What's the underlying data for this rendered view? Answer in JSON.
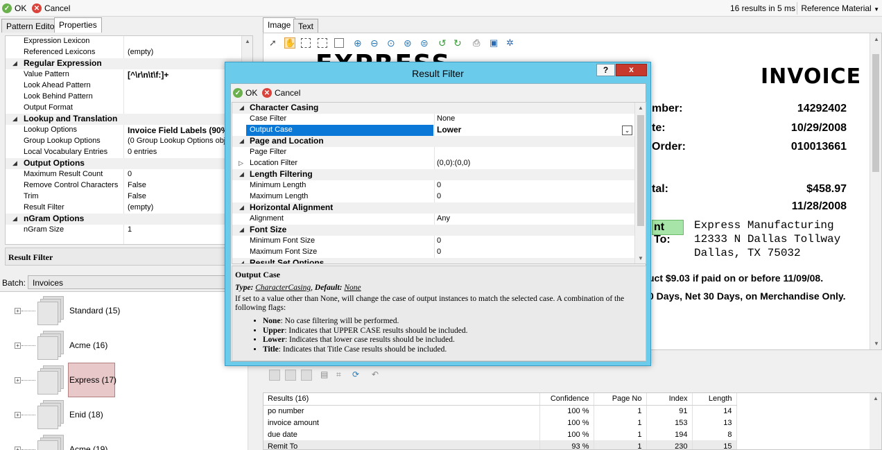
{
  "toolbar": {
    "ok_label": "OK",
    "cancel_label": "Cancel",
    "results_summary": "16 results in 5 ms",
    "reference_material": "Reference Material"
  },
  "left_tabs": [
    {
      "label": "Pattern Editor"
    },
    {
      "label": "Properties"
    }
  ],
  "properties": {
    "rows": [
      {
        "type": "prop",
        "name": "Expression Lexicon",
        "value": ""
      },
      {
        "type": "prop",
        "name": "Referenced Lexicons",
        "value": "(empty)"
      },
      {
        "type": "cat",
        "name": "Regular Expression"
      },
      {
        "type": "prop",
        "name": "Value Pattern",
        "value": "[^\\r\\n\\t\\f:]+",
        "bold": true
      },
      {
        "type": "prop",
        "name": "Look Ahead Pattern",
        "value": ""
      },
      {
        "type": "prop",
        "name": "Look Behind Pattern",
        "value": ""
      },
      {
        "type": "prop",
        "name": "Output Format",
        "value": ""
      },
      {
        "type": "cat",
        "name": "Lookup and Translation"
      },
      {
        "type": "prop",
        "name": "Lookup Options",
        "value": "Invoice Field Labels (90%",
        "bold": true
      },
      {
        "type": "prop",
        "name": "Group Lookup Options",
        "value": "(0 Group Lookup Options obje"
      },
      {
        "type": "prop",
        "name": "Local Vocabulary Entries",
        "value": "0 entries"
      },
      {
        "type": "cat",
        "name": "Output Options"
      },
      {
        "type": "prop",
        "name": "Maximum Result Count",
        "value": "0"
      },
      {
        "type": "prop",
        "name": "Remove Control Characters",
        "value": "False"
      },
      {
        "type": "prop",
        "name": "Trim",
        "value": "False"
      },
      {
        "type": "prop",
        "name": "Result Filter",
        "value": "(empty)"
      },
      {
        "type": "cat",
        "name": "nGram Options"
      },
      {
        "type": "prop",
        "name": "nGram Size",
        "value": "1"
      }
    ],
    "description_title": "Result Filter"
  },
  "batch": {
    "label": "Batch:",
    "value": "Invoices",
    "items": [
      {
        "label": "Standard (15)"
      },
      {
        "label": "Acme (16)"
      },
      {
        "label": "Express (17)"
      },
      {
        "label": "Enid (18)"
      },
      {
        "label": "Acme (19)"
      }
    ]
  },
  "right_tabs": [
    {
      "label": "Image"
    },
    {
      "label": "Text"
    }
  ],
  "invoice": {
    "brand": "EXPRESS",
    "title": "INVOICE",
    "lines": [
      {
        "label": "mber:",
        "value": "14292402"
      },
      {
        "label": "te:",
        "value": "10/29/2008"
      },
      {
        "label": "Order:",
        "value": "010013661"
      },
      {
        "label": "tal:",
        "value": "$458.97"
      },
      {
        "label": "",
        "value": "11/28/2008"
      }
    ],
    "remit_label": "nt To:",
    "address": [
      "Express Manufacturing",
      "12333 N Dallas Tollway",
      "Dallas, TX 75032"
    ],
    "note1": "uct $9.03 if paid on or before 11/09/08.",
    "note2": "0 Days, Net 30 Days, on Merchandise Only."
  },
  "results": {
    "headers": [
      "Results (16)",
      "Confidence",
      "Page No",
      "Index",
      "Length"
    ],
    "rows": [
      [
        "po number",
        "100 %",
        "1",
        "91",
        "14"
      ],
      [
        "invoice amount",
        "100 %",
        "1",
        "153",
        "13"
      ],
      [
        "due date",
        "100 %",
        "1",
        "194",
        "8"
      ],
      [
        "Remit To",
        "93 %",
        "1",
        "230",
        "15"
      ]
    ]
  },
  "dialog": {
    "title": "Result Filter",
    "help": "?",
    "close": "x",
    "ok_label": "OK",
    "cancel_label": "Cancel",
    "rows": [
      {
        "type": "cat",
        "name": "Character Casing"
      },
      {
        "type": "prop",
        "name": "Case Filter",
        "value": "None"
      },
      {
        "type": "prop",
        "name": "Output Case",
        "value": "Lower",
        "selected": true
      },
      {
        "type": "cat",
        "name": "Page and Location"
      },
      {
        "type": "prop",
        "name": "Page Filter",
        "value": ""
      },
      {
        "type": "prop",
        "name": "Location Filter",
        "value": "(0,0):(0,0)",
        "expand": true
      },
      {
        "type": "cat",
        "name": "Length Filtering"
      },
      {
        "type": "prop",
        "name": "Minimum Length",
        "value": "0"
      },
      {
        "type": "prop",
        "name": "Maximum Length",
        "value": "0"
      },
      {
        "type": "cat",
        "name": "Horizontal Alignment"
      },
      {
        "type": "prop",
        "name": "Alignment",
        "value": "Any"
      },
      {
        "type": "cat",
        "name": "Font Size"
      },
      {
        "type": "prop",
        "name": "Minimum Font Size",
        "value": "0"
      },
      {
        "type": "prop",
        "name": "Maximum Font Size",
        "value": "0"
      },
      {
        "type": "cat",
        "name": "Result Set Options"
      }
    ],
    "help_title": "Output Case",
    "type_label": "Type:",
    "type_value": "CharacterCasing",
    "default_label": "Default:",
    "default_value": "None",
    "description": "If set to a value other than None, will change the case of output instances to match the selected case. A combination of the following flags:",
    "flags": [
      {
        "name": "None",
        "text": ": No case filtering will be performed."
      },
      {
        "name": "Upper",
        "text": ": Indicates that UPPER CASE results should be included."
      },
      {
        "name": "Lower",
        "text": ": Indicates that lower case results should be included."
      },
      {
        "name": "Title",
        "text": ": Indicates that Title Case results should be included."
      }
    ]
  },
  "colors": {
    "dialog_title_bg": "#6bcbea",
    "selection": "#0a78d7",
    "close_btn": "#c7392d"
  }
}
